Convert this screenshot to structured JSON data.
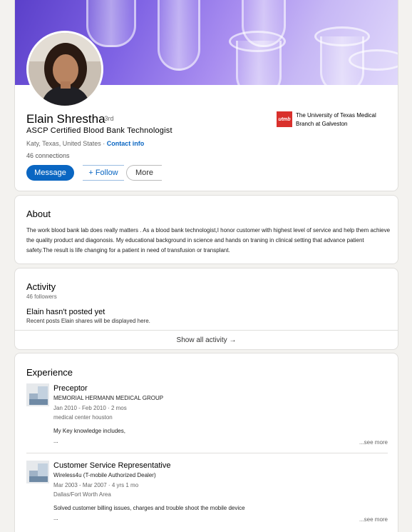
{
  "profile": {
    "name": "Elain Shrestha",
    "degree": "· 3rd",
    "headline": "ASCP Certified Blood Bank Technologist",
    "location": "Katy, Texas, United States ·",
    "contact_info": "Contact info",
    "connections": "46 connections",
    "buttons": {
      "message": "Message",
      "follow": "+ Follow",
      "more": "More"
    },
    "education": {
      "logo_text": "utmb",
      "name": "The University of Texas Medical Branch at Galveston"
    },
    "colors": {
      "accent": "#0a66c2",
      "utmb_red": "#d9302c"
    }
  },
  "about": {
    "title": "About",
    "text": "The work blood bank lab does really matters . As a blood bank technologist,I honor customer with highest level of service and help them achieve the quality product and diagonosis. My educational background in science and hands on traning in clinical setting that advance patient safety.The result is life changing for a patient in need of transfusion or transplant."
  },
  "activity": {
    "title": "Activity",
    "followers": "46 followers",
    "empty_title": "Elain hasn't posted yet",
    "empty_sub": "Recent posts Elain shares will be displayed here.",
    "show_all": "Show all activity →"
  },
  "experience": {
    "title": "Experience",
    "items": [
      {
        "title": "Preceptor",
        "company": "MEMORIAL HERMANN MEDICAL GROUP",
        "dates": "Jan 2010 - Feb 2010 · 2 mos",
        "location": "medical center houston",
        "desc1": "My Key knowledge includes,",
        "desc2": "...",
        "see_more": "...see more"
      },
      {
        "title": "Customer Service Representative",
        "company": "Wireless4u (T-mobile Authorized Dealer)",
        "dates": "Mar 2003 - Mar 2007 · 4 yrs 1 mo",
        "location": "Dallas/Fort Worth Area",
        "desc1": "Solved customer billing issues, charges and trouble shoot the mobile device",
        "desc2": "...",
        "see_more": "...see more"
      }
    ]
  }
}
